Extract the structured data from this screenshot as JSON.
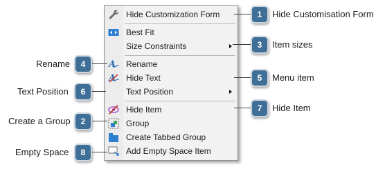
{
  "menu": {
    "items": [
      {
        "label": "Hide Customization Form",
        "icon": "wrench-icon"
      },
      {
        "label": "Best Fit",
        "icon": "best-fit-icon"
      },
      {
        "label": "Size Constraints",
        "icon": "",
        "submenu": true
      },
      {
        "label": "Rename",
        "icon": "rename-icon"
      },
      {
        "label": "Hide Text",
        "icon": "hide-text-icon"
      },
      {
        "label": "Text Position",
        "icon": "",
        "submenu": true
      },
      {
        "label": "Hide Item",
        "icon": "hide-item-icon"
      },
      {
        "label": "Group",
        "icon": "group-icon"
      },
      {
        "label": "Create Tabbed Group",
        "icon": "tabbed-group-icon"
      },
      {
        "label": "Add Empty Space Item",
        "icon": "empty-space-icon"
      }
    ]
  },
  "callouts": {
    "c1": {
      "number": "1",
      "text": "Hide Customisation Form"
    },
    "c3": {
      "number": "3",
      "text": "Item sizes"
    },
    "c4": {
      "number": "4",
      "text": "Rename"
    },
    "c5": {
      "number": "5",
      "text": "Menu item"
    },
    "c6": {
      "number": "6",
      "text": "Text Position"
    },
    "c7": {
      "number": "7",
      "text": "Hide Item"
    },
    "c2": {
      "number": "2",
      "text": "Create a Group"
    },
    "c8": {
      "number": "8",
      "text": "Empty Space"
    }
  },
  "colors": {
    "badge": "#3f6f96",
    "accent_red": "#c0392b",
    "accent_blue": "#2f7fd0"
  }
}
